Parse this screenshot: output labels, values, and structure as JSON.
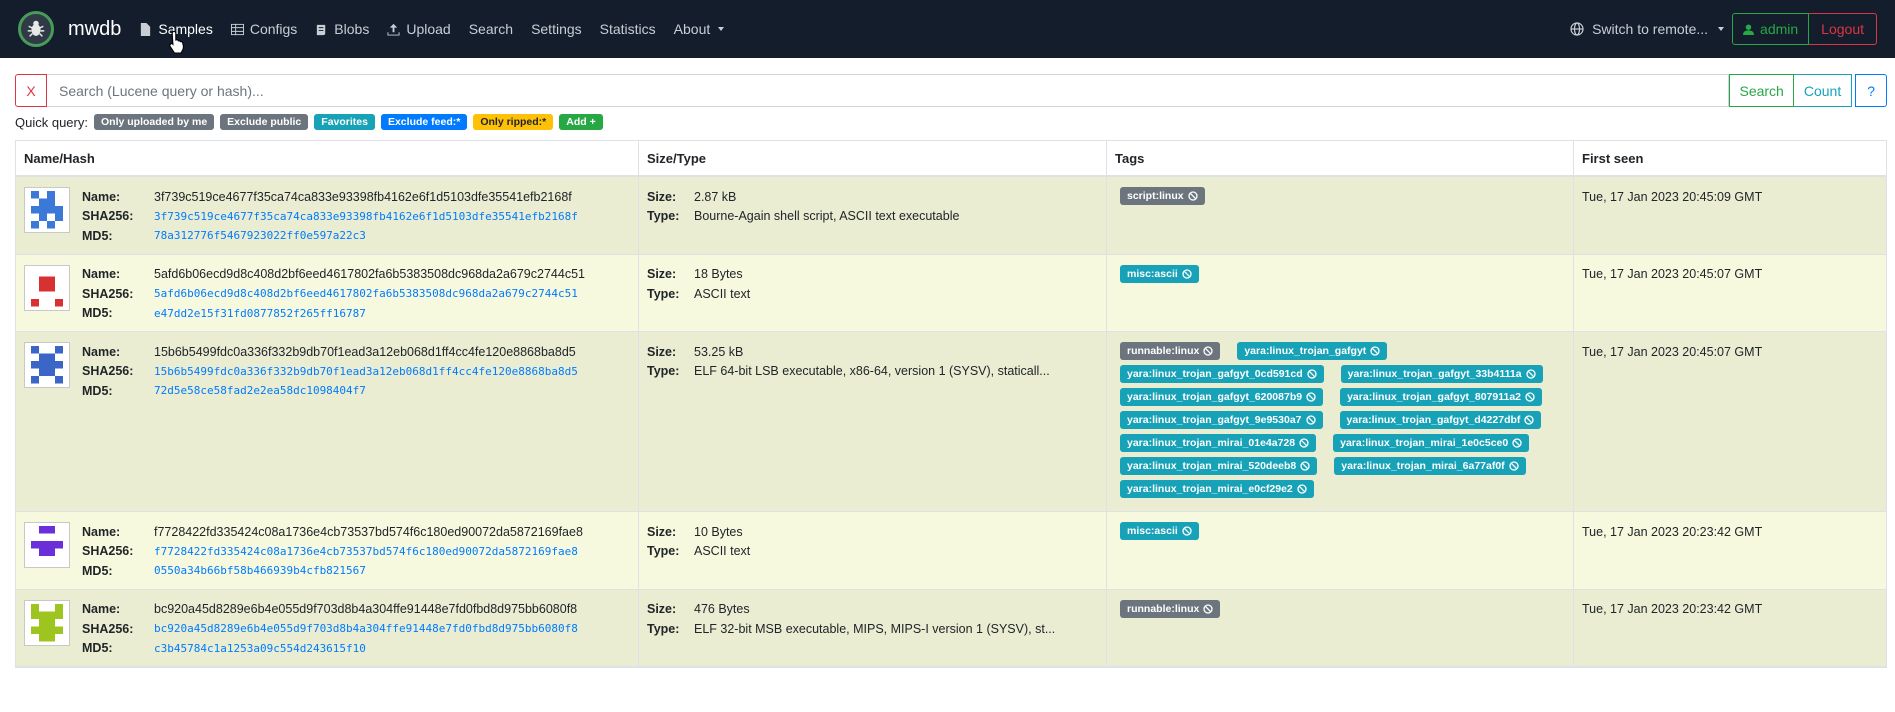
{
  "nav": {
    "brand": "mwdb",
    "items": [
      {
        "label": "Samples",
        "icon": "file-icon"
      },
      {
        "label": "Configs",
        "icon": "table-icon"
      },
      {
        "label": "Blobs",
        "icon": "scroll-icon"
      },
      {
        "label": "Upload",
        "icon": "upload-icon"
      },
      {
        "label": "Search",
        "icon": ""
      },
      {
        "label": "Settings",
        "icon": ""
      },
      {
        "label": "Statistics",
        "icon": ""
      },
      {
        "label": "About",
        "icon": "caret-down-icon"
      }
    ],
    "remote_label": "Switch to remote...",
    "user_label": "admin",
    "logout_label": "Logout"
  },
  "search": {
    "clear_label": "X",
    "placeholder": "Search (Lucene query or hash)...",
    "search_label": "Search",
    "count_label": "Count",
    "help_label": "?"
  },
  "quick_query": {
    "label": "Quick query:",
    "badges": [
      {
        "label": "Only uploaded by me",
        "color": "#6c757d"
      },
      {
        "label": "Exclude public",
        "color": "#6c757d"
      },
      {
        "label": "Favorites",
        "color": "#17a2b8"
      },
      {
        "label": "Exclude feed:*",
        "color": "#007bff"
      },
      {
        "label": "Only ripped:*",
        "color": "#ffc107"
      },
      {
        "label": "Add +",
        "color": "#28a745"
      }
    ]
  },
  "table": {
    "headers": [
      "Name/Hash",
      "Size/Type",
      "Tags",
      "First seen"
    ],
    "keys": {
      "name": "Name:",
      "sha256": "SHA256:",
      "md5": "MD5:",
      "size": "Size:",
      "type": "Type:"
    },
    "rows": [
      {
        "name": "3f739c519ce4677f35ca74ca833e93398fb4162e6f1d5103dfe35541efb2168f",
        "sha256": "3f739c519ce4677f35ca74ca833e93398fb4162e6f1d5103dfe35541efb2168f",
        "md5": "78a312776f5467923022ff0e597a22c3",
        "size": "2.87 kB",
        "type": "Bourne-Again shell script, ASCII text executable",
        "tags": [
          {
            "label": "script:linux",
            "color": "gray"
          }
        ],
        "first_seen": "Tue, 17 Jan 2023 20:45:09 GMT"
      },
      {
        "name": "5afd6b06ecd9d8c408d2bf6eed4617802fa6b5383508dc968da2a679c2744c51",
        "sha256": "5afd6b06ecd9d8c408d2bf6eed4617802fa6b5383508dc968da2a679c2744c51",
        "md5": "e47dd2e15f31fd0877852f265ff16787",
        "size": "18 Bytes",
        "type": "ASCII text",
        "tags": [
          {
            "label": "misc:ascii",
            "color": "teal"
          }
        ],
        "first_seen": "Tue, 17 Jan 2023 20:45:07 GMT"
      },
      {
        "name": "15b6b5499fdc0a336f332b9db70f1ead3a12eb068d1ff4cc4fe120e8868ba8d5",
        "sha256": "15b6b5499fdc0a336f332b9db70f1ead3a12eb068d1ff4cc4fe120e8868ba8d5",
        "md5": "72d5e58ce58fad2e2ea58dc1098404f7",
        "size": "53.25 kB",
        "type": "ELF 64-bit LSB executable, x86-64, version 1 (SYSV), staticall...",
        "tags": [
          {
            "label": "runnable:linux",
            "color": "gray"
          },
          {
            "label": "yara:linux_trojan_gafgyt",
            "color": "teal"
          },
          {
            "label": "yara:linux_trojan_gafgyt_0cd591cd",
            "color": "teal"
          },
          {
            "label": "yara:linux_trojan_gafgyt_33b4111a",
            "color": "teal"
          },
          {
            "label": "yara:linux_trojan_gafgyt_620087b9",
            "color": "teal"
          },
          {
            "label": "yara:linux_trojan_gafgyt_807911a2",
            "color": "teal"
          },
          {
            "label": "yara:linux_trojan_gafgyt_9e9530a7",
            "color": "teal"
          },
          {
            "label": "yara:linux_trojan_gafgyt_d4227dbf",
            "color": "teal"
          },
          {
            "label": "yara:linux_trojan_mirai_01e4a728",
            "color": "teal"
          },
          {
            "label": "yara:linux_trojan_mirai_1e0c5ce0",
            "color": "teal"
          },
          {
            "label": "yara:linux_trojan_mirai_520deeb8",
            "color": "teal"
          },
          {
            "label": "yara:linux_trojan_mirai_6a77af0f",
            "color": "teal"
          },
          {
            "label": "yara:linux_trojan_mirai_e0cf29e2",
            "color": "teal"
          }
        ],
        "first_seen": "Tue, 17 Jan 2023 20:45:07 GMT"
      },
      {
        "name": "f7728422fd335424c08a1736e4cb73537bd574f6c180ed90072da5872169fae8",
        "sha256": "f7728422fd335424c08a1736e4cb73537bd574f6c180ed90072da5872169fae8",
        "md5": "0550a34b66bf58b466939b4cfb821567",
        "size": "10 Bytes",
        "type": "ASCII text",
        "tags": [
          {
            "label": "misc:ascii",
            "color": "teal"
          }
        ],
        "first_seen": "Tue, 17 Jan 2023 20:23:42 GMT"
      },
      {
        "name": "bc920a45d8289e6b4e055d9f703d8b4a304ffe91448e7fd0fbd8d975bb6080f8",
        "sha256": "bc920a45d8289e6b4e055d9f703d8b4a304ffe91448e7fd0fbd8d975bb6080f8",
        "md5": "c3b45784c1a1253a09c554d243615f10",
        "size": "476 Bytes",
        "type": "ELF 32-bit MSB executable, MIPS, MIPS-I version 1 (SYSV), st...",
        "tags": [
          {
            "label": "runnable:linux",
            "color": "gray"
          }
        ],
        "first_seen": "Tue, 17 Jan 2023 20:23:42 GMT"
      }
    ]
  }
}
